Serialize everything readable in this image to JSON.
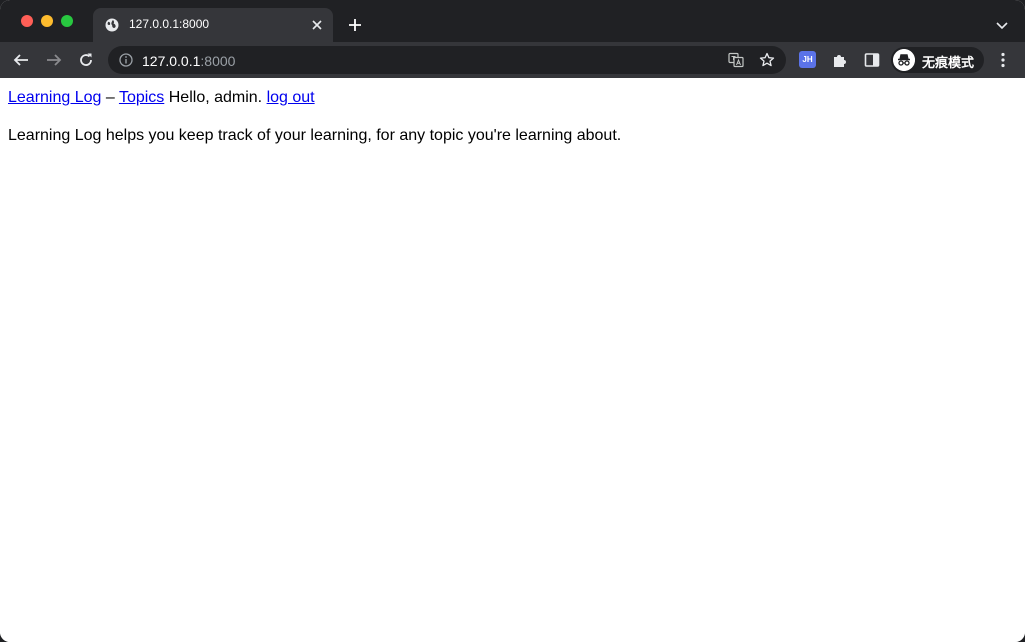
{
  "browser": {
    "tab": {
      "title": "127.0.0.1:8000",
      "favicon": "globe-icon"
    },
    "omnibox": {
      "host": "127.0.0.1",
      "port": ":8000"
    },
    "extension_badge": "JH",
    "incognito_label": "无痕模式",
    "colors": {
      "titlebar": "#202124",
      "toolbar": "#35363a",
      "omnibox": "#202124",
      "extension": "#5b73e8"
    }
  },
  "page": {
    "nav": {
      "home_link": "Learning Log",
      "separator": "–",
      "topics_link": "Topics",
      "greeting": "Hello, admin.",
      "logout_link": "log out"
    },
    "description": "Learning Log helps you keep track of your learning, for any topic you're learning about.",
    "colors": {
      "link": "#0000ee",
      "text": "#000000",
      "background": "#ffffff"
    }
  }
}
